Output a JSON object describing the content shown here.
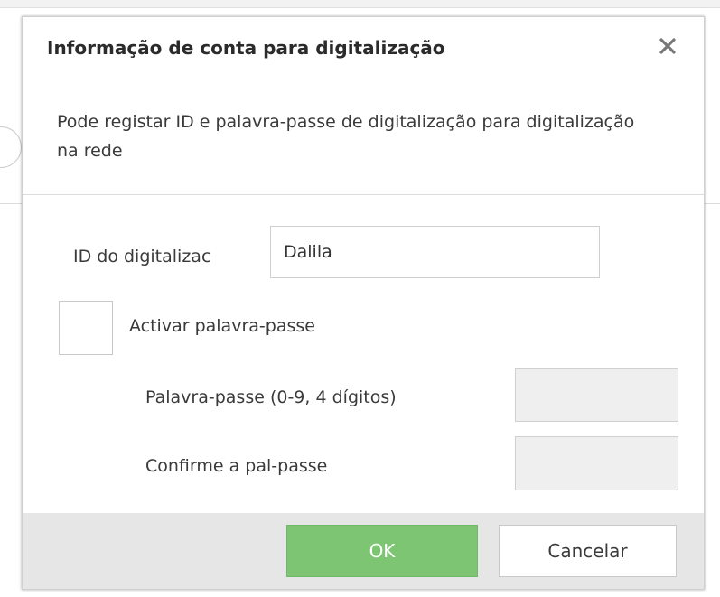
{
  "dialog": {
    "title": "Informação de conta para digitalização",
    "close_icon": "close-icon",
    "description": "Pode registar ID e palavra-passe de digitalização para digitalização na rede"
  },
  "form": {
    "scanner_id_label": "ID do digitalizac",
    "scanner_id_value": "Dalila",
    "enable_password_label": "Activar palavra-passe",
    "enable_password_checked": false,
    "password_label": "Palavra-passe (0-9, 4 dígitos)",
    "password_value": "",
    "confirm_password_label": "Confirme a pal-passe",
    "confirm_password_value": ""
  },
  "footer": {
    "ok_label": "OK",
    "cancel_label": "Cancelar"
  },
  "colors": {
    "ok_button": "#7dc573",
    "footer_background": "#e6e6e6",
    "disabled_input": "#efefef"
  }
}
